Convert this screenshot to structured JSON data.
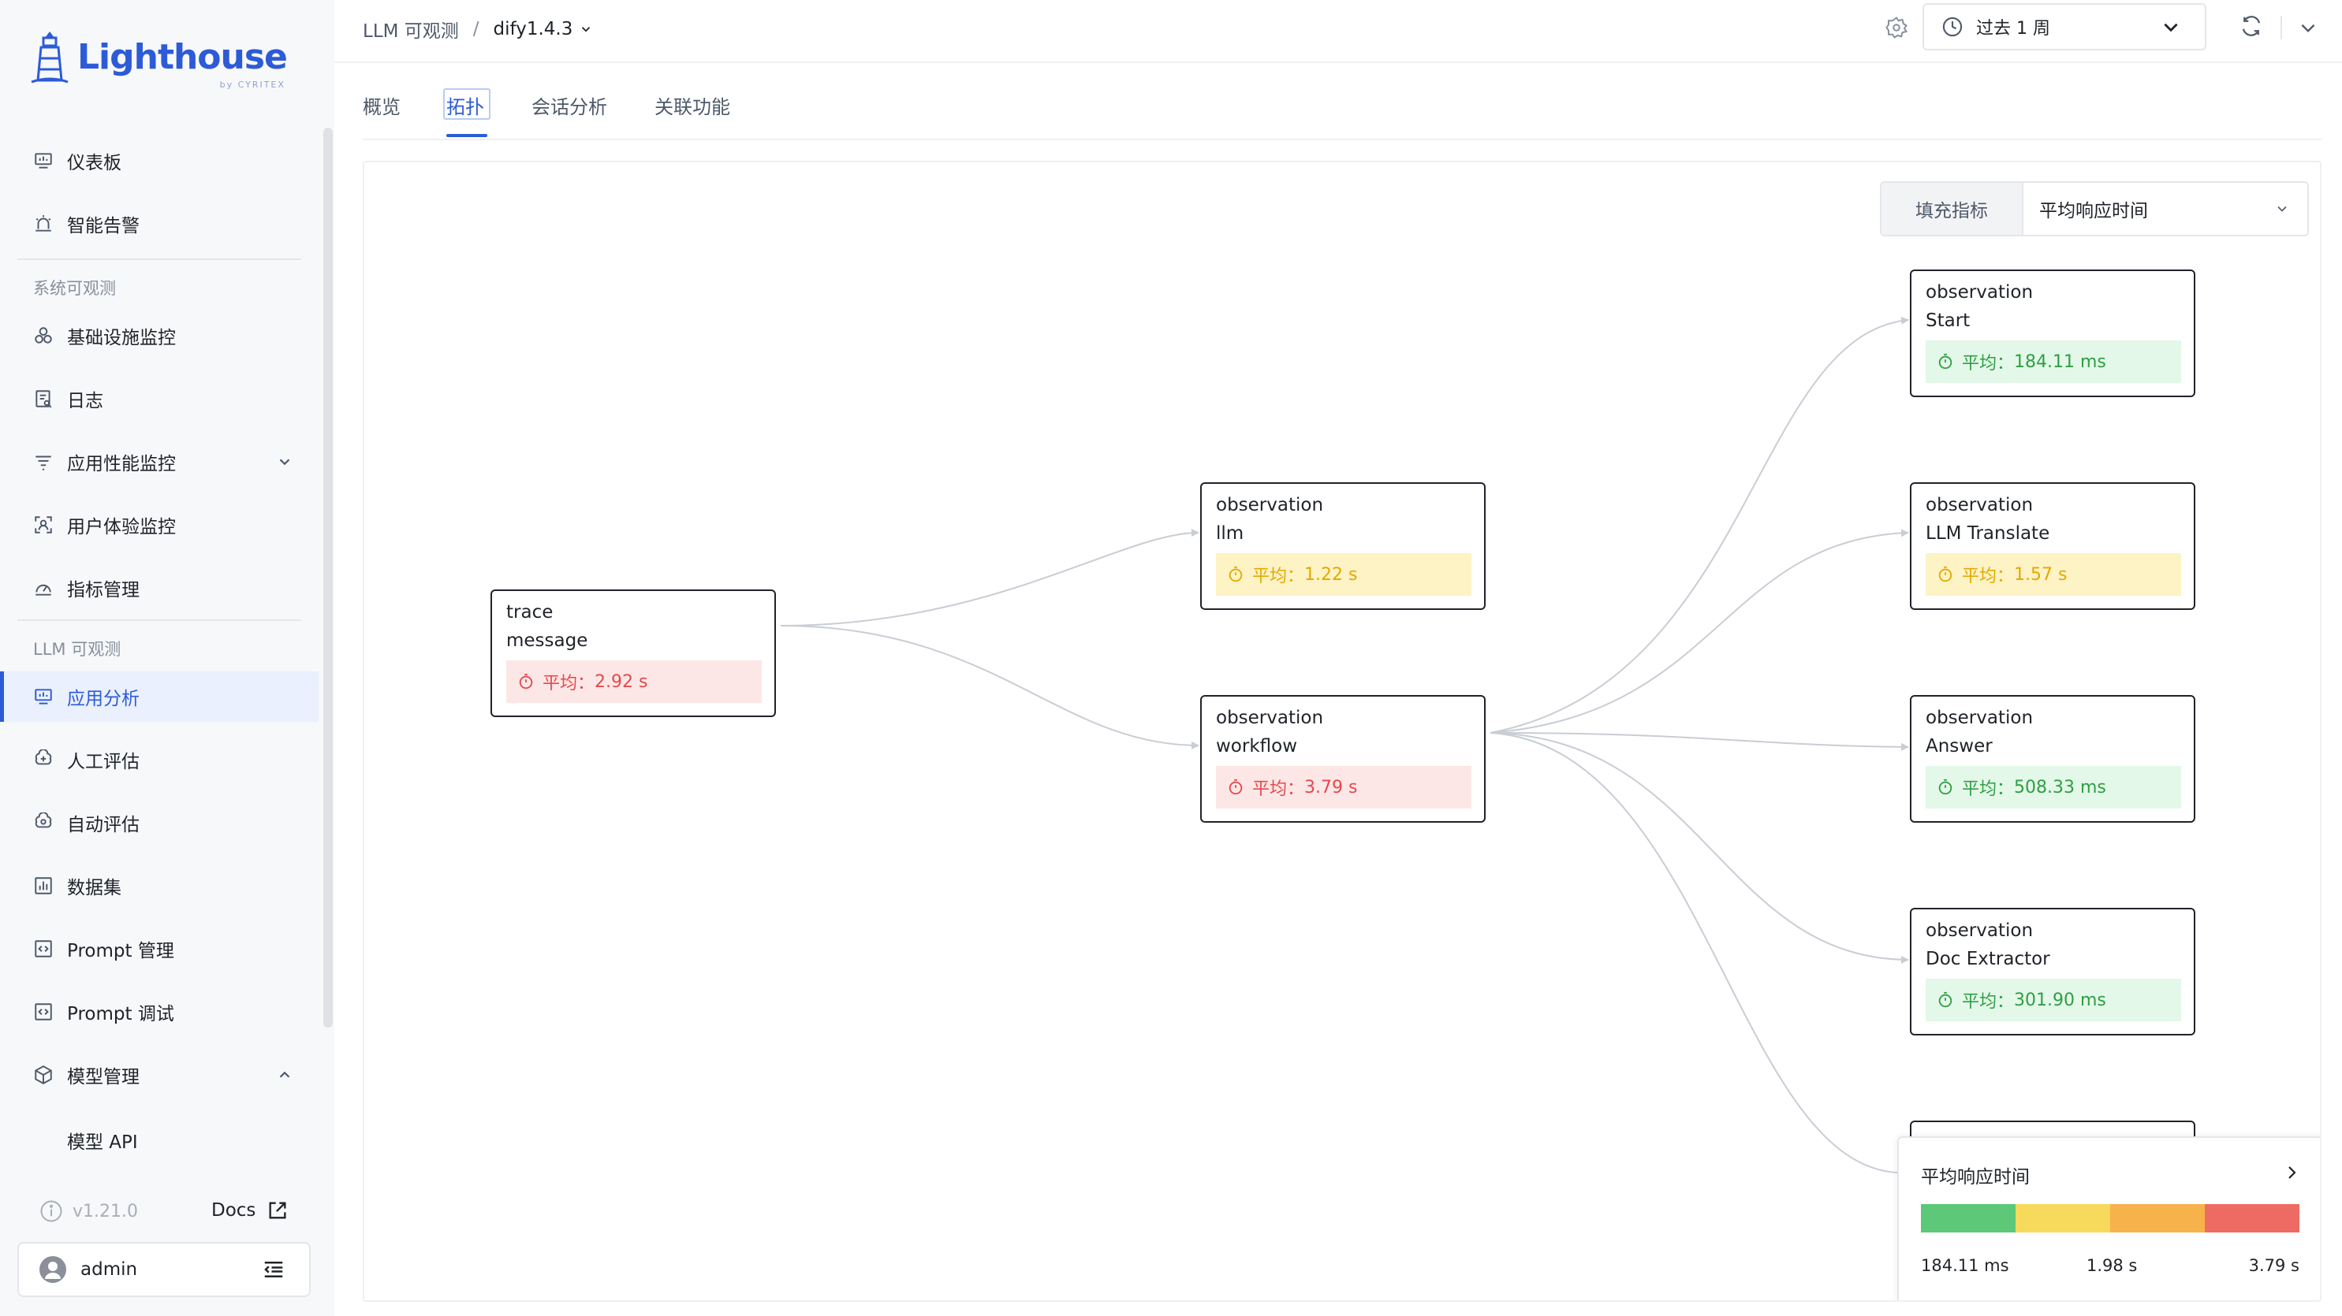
{
  "brand": {
    "name_a": "Light",
    "name_b": "house",
    "sub": "by CYRITEX"
  },
  "sidebar": {
    "items": [
      {
        "label": "仪表板",
        "icon": "dashboard-icon"
      },
      {
        "label": "智能告警",
        "icon": "alarm-icon"
      },
      {
        "label": "基础设施监控",
        "icon": "infrastructure-icon"
      },
      {
        "label": "日志",
        "icon": "log-icon"
      },
      {
        "label": "应用性能监控",
        "icon": "apm-icon"
      },
      {
        "label": "用户体验监控",
        "icon": "user-experience-icon"
      },
      {
        "label": "指标管理",
        "icon": "metrics-icon"
      },
      {
        "label": "应用分析",
        "icon": "app-analysis-icon"
      },
      {
        "label": "人工评估",
        "icon": "human-eval-icon"
      },
      {
        "label": "自动评估",
        "icon": "auto-eval-icon"
      },
      {
        "label": "数据集",
        "icon": "dataset-icon"
      },
      {
        "label": "Prompt 管理",
        "icon": "prompt-manage-icon"
      },
      {
        "label": "Prompt 调试",
        "icon": "prompt-debug-icon"
      },
      {
        "label": "模型管理",
        "icon": "model-manage-icon"
      }
    ],
    "sections": {
      "system": "系统可观测",
      "llm": "LLM 可观测"
    },
    "sub_items": {
      "model_api": "模型 API"
    },
    "version": "v1.21.0",
    "docs": "Docs",
    "user": "admin"
  },
  "header": {
    "breadcrumb": {
      "section": "LLM 可观测",
      "separator": "/",
      "app": "dify1.4.3"
    },
    "time_range": "过去 1 周"
  },
  "tabs": [
    "概览",
    "拓扑",
    "会话分析",
    "关联功能"
  ],
  "topology": {
    "fill_metric_label": "填充指标",
    "fill_metric_value": "平均响应时间",
    "metric_prefix": "平均：",
    "nodes": [
      {
        "id": "trace-message",
        "type": "trace",
        "name": "message",
        "metric": "2.92 s",
        "level": "red"
      },
      {
        "id": "obs-llm",
        "type": "observation",
        "name": "llm",
        "metric": "1.22 s",
        "level": "yellow"
      },
      {
        "id": "obs-workflow",
        "type": "observation",
        "name": "workflow",
        "metric": "3.79 s",
        "level": "red"
      },
      {
        "id": "obs-start",
        "type": "observation",
        "name": "Start",
        "metric": "184.11 ms",
        "level": "green"
      },
      {
        "id": "obs-llm-translate",
        "type": "observation",
        "name": "LLM Translate",
        "metric": "1.57 s",
        "level": "yellow"
      },
      {
        "id": "obs-answer",
        "type": "observation",
        "name": "Answer",
        "metric": "508.33 ms",
        "level": "green"
      },
      {
        "id": "obs-doc-extractor",
        "type": "observation",
        "name": "Doc Extractor",
        "metric": "301.90 ms",
        "level": "green"
      }
    ],
    "edges": [
      [
        "trace-message",
        "obs-llm"
      ],
      [
        "trace-message",
        "obs-workflow"
      ],
      [
        "obs-workflow",
        "obs-start"
      ],
      [
        "obs-workflow",
        "obs-llm-translate"
      ],
      [
        "obs-workflow",
        "obs-answer"
      ],
      [
        "obs-workflow",
        "obs-doc-extractor"
      ],
      [
        "obs-workflow",
        "obs-hidden"
      ]
    ],
    "legend": {
      "title": "平均响应时间",
      "min": "184.11 ms",
      "mid": "1.98 s",
      "max": "3.79 s",
      "colors": [
        "#5cc878",
        "#f7d95c",
        "#f8b24c",
        "#ee6b63"
      ]
    }
  },
  "colors": {
    "accent": "#2d5bd8",
    "red": "#e5484d",
    "yellow": "#e6a700",
    "green": "#2f9e44"
  }
}
